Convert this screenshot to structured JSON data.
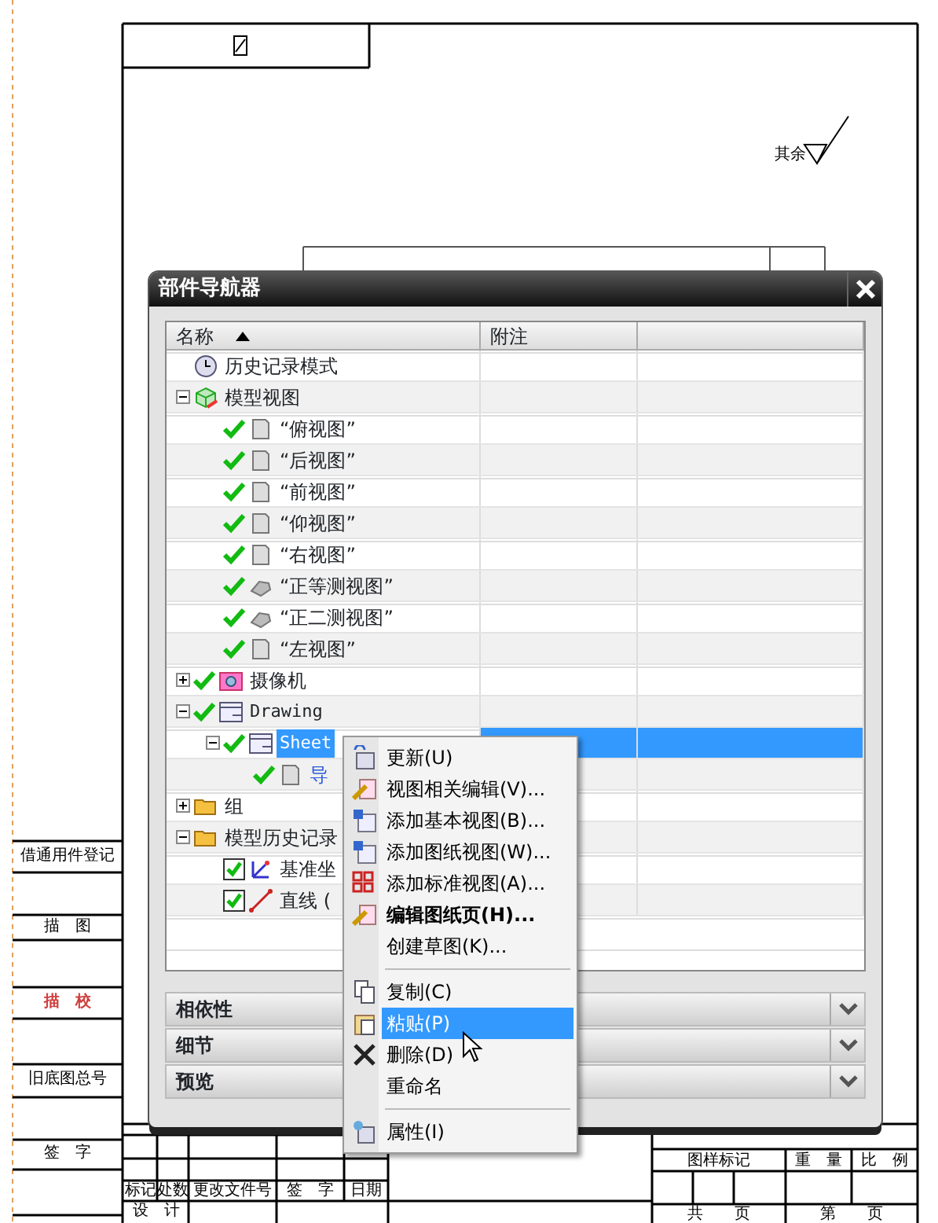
{
  "drawing": {
    "note": "其余",
    "side_labels": [
      {
        "label": "借通用件登记",
        "highlighted": false
      },
      {
        "label": "描　图",
        "highlighted": false
      },
      {
        "label": "描　校",
        "highlighted": true
      },
      {
        "label": "旧底图总号",
        "highlighted": false
      },
      {
        "label": "签　字",
        "highlighted": false
      }
    ],
    "revision_headers": [
      "标记",
      "处数",
      "更改文件号",
      "签　字",
      "日期"
    ],
    "revision_rows": [
      "设　计"
    ],
    "title_block": [
      "图样标记",
      "重　量",
      "比　例",
      "共　　页",
      "第　　页"
    ]
  },
  "navigator": {
    "title": "部件导航器",
    "columns": [
      {
        "label": "名称",
        "sorted": true
      },
      {
        "label": "附注",
        "sorted": false
      }
    ],
    "tree": [
      {
        "label": "历史记录模式",
        "kind": "clock"
      },
      {
        "label": "模型视图",
        "kind": "views",
        "expanded": true,
        "children": [
          {
            "label": "“俯视图”",
            "kind": "view",
            "checked": true
          },
          {
            "label": "“后视图”",
            "kind": "view",
            "checked": true
          },
          {
            "label": "“前视图”",
            "kind": "view",
            "checked": true
          },
          {
            "label": "“仰视图”",
            "kind": "view",
            "checked": true
          },
          {
            "label": "“右视图”",
            "kind": "view",
            "checked": true
          },
          {
            "label": "“正等测视图”",
            "kind": "iso",
            "checked": true
          },
          {
            "label": "“正二测视图”",
            "kind": "iso",
            "checked": true
          },
          {
            "label": "“左视图”",
            "kind": "view",
            "checked": true
          }
        ]
      },
      {
        "label": "摄像机",
        "kind": "camera",
        "checked": true,
        "expanded": false
      },
      {
        "label": "Drawing",
        "kind": "sheet",
        "checked": true,
        "expanded": true,
        "mono": true,
        "children": [
          {
            "label": "Sheet",
            "kind": "sheet",
            "checked": true,
            "expanded": true,
            "mono": true,
            "selected": true,
            "children": [
              {
                "label": "导",
                "kind": "view",
                "checked": true,
                "link": true
              }
            ]
          }
        ]
      },
      {
        "label": "组",
        "kind": "folder",
        "expanded": false
      },
      {
        "label": "模型历史记录",
        "kind": "folder",
        "expanded": true,
        "children": [
          {
            "label": "基准坐",
            "kind": "datum",
            "checked": true
          },
          {
            "label": "直线 (",
            "kind": "line",
            "checked": true
          }
        ]
      }
    ],
    "panels": [
      {
        "label": "相依性"
      },
      {
        "label": "细节"
      },
      {
        "label": "预览"
      }
    ]
  },
  "context_menu": [
    {
      "kind": "refresh",
      "label": "更新(U)",
      "selected": false
    },
    {
      "kind": "edit",
      "label": "视图相关编辑(V)...",
      "selected": false
    },
    {
      "kind": "addview",
      "label": "添加基本视图(B)...",
      "selected": false
    },
    {
      "kind": "addview",
      "label": "添加图纸视图(W)...",
      "selected": false
    },
    {
      "kind": "grid",
      "label": "添加标准视图(A)...",
      "selected": false
    },
    {
      "kind": "edit",
      "label": "编辑图纸页(H)...",
      "bold": true,
      "selected": false
    },
    {
      "kind": "plain",
      "label": "创建草图(K)...",
      "selected": false
    },
    {
      "kind": "separator"
    },
    {
      "kind": "copy",
      "label": "复制(C)",
      "selected": false
    },
    {
      "kind": "paste",
      "label": "粘贴(P)",
      "selected": true
    },
    {
      "kind": "delete",
      "label": "删除(D)",
      "selected": false
    },
    {
      "kind": "plain",
      "label": "重命名",
      "selected": false
    },
    {
      "kind": "separator"
    },
    {
      "kind": "props",
      "label": "属性(I)",
      "selected": false
    }
  ]
}
